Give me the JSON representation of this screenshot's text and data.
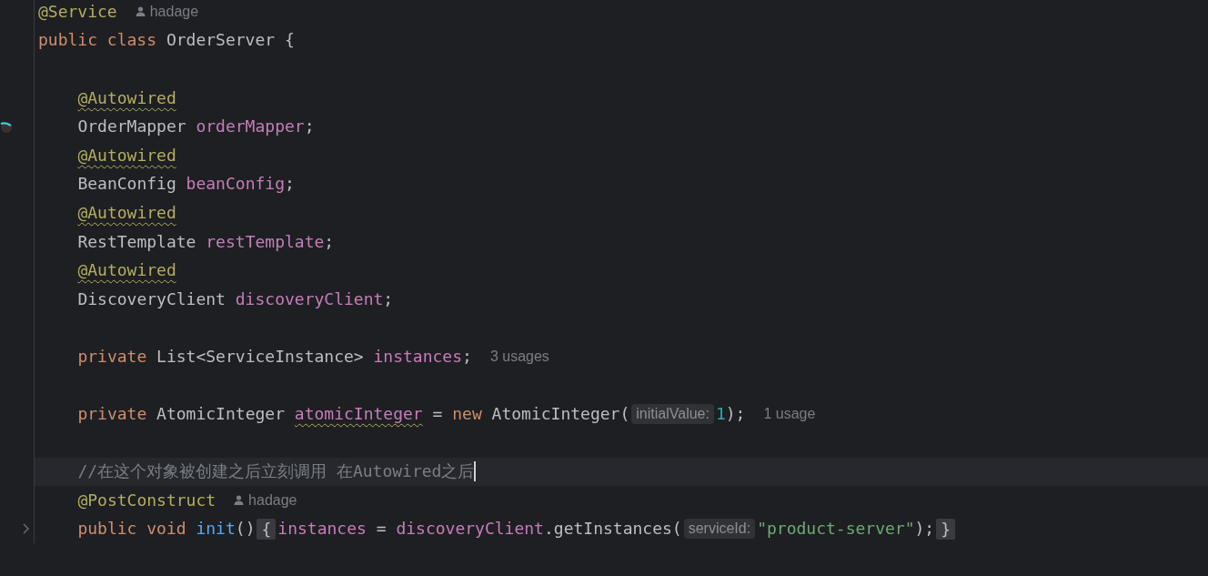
{
  "lines": [
    {
      "kind": "code",
      "tokens": [
        {
          "kind": "annotation",
          "text": "@Service"
        },
        {
          "kind": "author",
          "text": "hadage"
        }
      ]
    },
    {
      "kind": "code",
      "tokens": [
        {
          "kind": "keyword",
          "text": "public "
        },
        {
          "kind": "keyword",
          "text": "class "
        },
        {
          "kind": "plain",
          "text": "OrderServer {"
        }
      ],
      "children": [
        {
          "kind": "blank"
        },
        {
          "kind": "code",
          "tokens": [
            {
              "kind": "annotation",
              "text": "@Autowired",
              "underlined": true
            }
          ]
        },
        {
          "kind": "code",
          "gutter_marker": true,
          "tokens": [
            {
              "kind": "plain",
              "text": "OrderMapper "
            },
            {
              "kind": "field",
              "text": "orderMapper"
            },
            {
              "kind": "plain",
              "text": ";"
            }
          ]
        },
        {
          "kind": "code",
          "tokens": [
            {
              "kind": "annotation",
              "text": "@Autowired",
              "underlined": true
            }
          ]
        },
        {
          "kind": "code",
          "tokens": [
            {
              "kind": "plain",
              "text": "BeanConfig "
            },
            {
              "kind": "field",
              "text": "beanConfig"
            },
            {
              "kind": "plain",
              "text": ";"
            }
          ]
        },
        {
          "kind": "code",
          "tokens": [
            {
              "kind": "annotation",
              "text": "@Autowired",
              "underlined": true
            }
          ]
        },
        {
          "kind": "code",
          "tokens": [
            {
              "kind": "plain",
              "text": "RestTemplate "
            },
            {
              "kind": "field",
              "text": "restTemplate"
            },
            {
              "kind": "plain",
              "text": ";"
            }
          ]
        },
        {
          "kind": "code",
          "tokens": [
            {
              "kind": "annotation",
              "text": "@Autowired",
              "underlined": true
            }
          ]
        },
        {
          "kind": "code",
          "tokens": [
            {
              "kind": "plain",
              "text": "DiscoveryClient "
            },
            {
              "kind": "field",
              "text": "discoveryClient"
            },
            {
              "kind": "plain",
              "text": ";"
            }
          ]
        },
        {
          "kind": "blank"
        },
        {
          "kind": "code",
          "tokens": [
            {
              "kind": "keyword",
              "text": "private "
            },
            {
              "kind": "plain",
              "text": "List<ServiceInstance> "
            },
            {
              "kind": "field",
              "text": "instances"
            },
            {
              "kind": "plain",
              "text": ";"
            },
            {
              "kind": "usages",
              "text": "3 usages"
            }
          ]
        },
        {
          "kind": "blank"
        },
        {
          "kind": "code",
          "tokens": [
            {
              "kind": "keyword",
              "text": "private "
            },
            {
              "kind": "plain",
              "text": "AtomicInteger "
            },
            {
              "kind": "field",
              "text": "atomicInteger",
              "underlined": true
            },
            {
              "kind": "plain",
              "text": " = "
            },
            {
              "kind": "keyword",
              "text": "new "
            },
            {
              "kind": "plain",
              "text": "AtomicInteger("
            },
            {
              "kind": "hint",
              "text": "initialValue:"
            },
            {
              "kind": "number",
              "text": "1"
            },
            {
              "kind": "plain",
              "text": ");"
            },
            {
              "kind": "usages",
              "text": "1 usage"
            }
          ]
        },
        {
          "kind": "blank"
        },
        {
          "kind": "code",
          "current": true,
          "tokens": [
            {
              "kind": "comment",
              "text": "//在这个对象被创建之后立刻调用 在Autowired之后"
            }
          ]
        },
        {
          "kind": "code",
          "tokens": [
            {
              "kind": "annotation",
              "text": "@PostConstruct"
            },
            {
              "kind": "author",
              "text": "hadage"
            }
          ]
        },
        {
          "kind": "code",
          "folded": true,
          "tokens": [
            {
              "kind": "keyword",
              "text": "public "
            },
            {
              "kind": "keyword",
              "text": "void "
            },
            {
              "kind": "method",
              "text": "init"
            },
            {
              "kind": "plain",
              "text": "()"
            },
            {
              "kind": "fold",
              "text": "{"
            },
            {
              "kind": "field",
              "text": "instances"
            },
            {
              "kind": "plain",
              "text": " = "
            },
            {
              "kind": "field",
              "text": "discoveryClient"
            },
            {
              "kind": "plain",
              "text": ".getInstances("
            },
            {
              "kind": "hint",
              "text": "serviceId:"
            },
            {
              "kind": "string",
              "text": "\"product-server\""
            },
            {
              "kind": "plain",
              "text": ");"
            },
            {
              "kind": "fold",
              "text": "}"
            }
          ]
        }
      ]
    }
  ]
}
